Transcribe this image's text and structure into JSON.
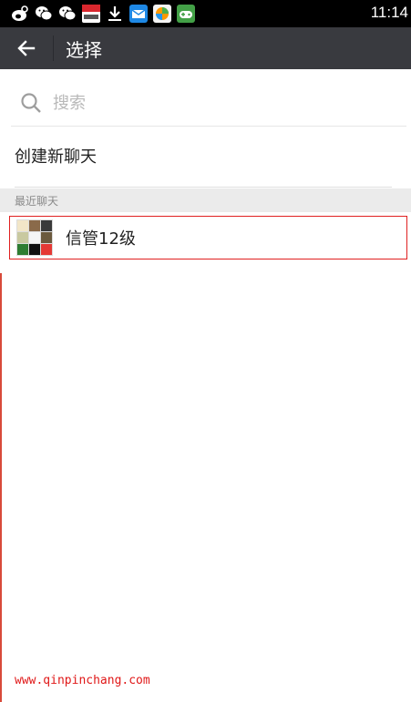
{
  "status_bar": {
    "icons": [
      "weibo-icon",
      "wechat-icon",
      "wechat-icon",
      "youku-app-icon",
      "download-icon",
      "mail-icon",
      "app-market-icon",
      "game-icon"
    ],
    "time": "11:14"
  },
  "header": {
    "title": "选择"
  },
  "search": {
    "placeholder": "搜索"
  },
  "create_chat": {
    "label": "创建新聊天"
  },
  "recent": {
    "section_label": "最近聊天",
    "items": [
      {
        "name": "信管12级"
      }
    ]
  },
  "watermark": "www.qinpinchang.com",
  "colors": {
    "title_bar": "#393a3f",
    "status_bar": "#000000",
    "section_bg": "#ebebeb",
    "highlight_border": "#e02020",
    "watermark": "#e01818"
  }
}
